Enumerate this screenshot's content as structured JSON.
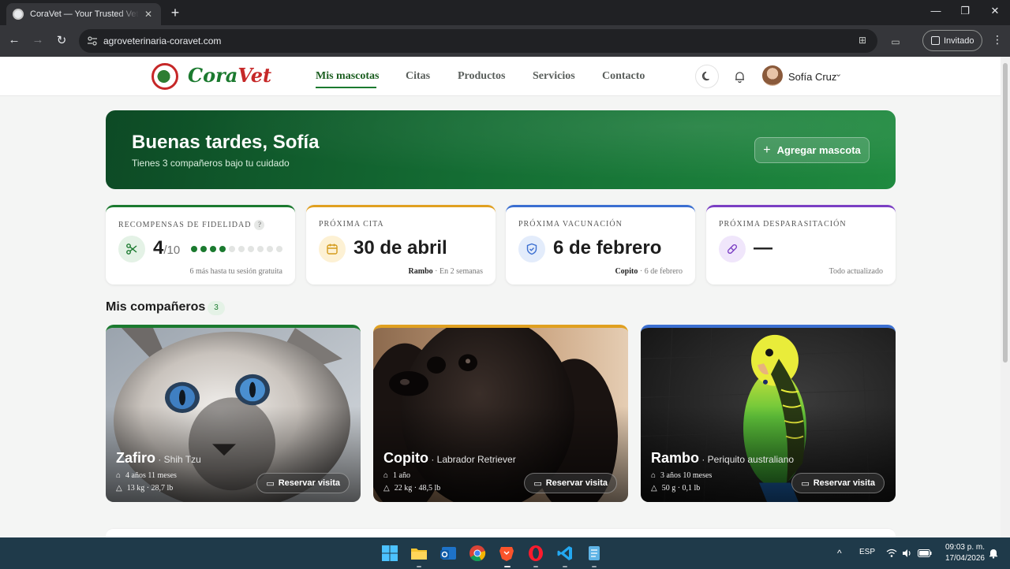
{
  "browser": {
    "tab_title": "CoraVet — Your Trusted Veterinary",
    "tab_close": "✕",
    "new_tab": "+",
    "url": "agroveterinaria-coravet.com",
    "profile_label": "Invitado",
    "controls": {
      "minimize": "—",
      "maximize": "❐",
      "close": "✕"
    }
  },
  "site": {
    "logo": {
      "part1": "Cora",
      "part2": "Vet"
    },
    "nav": [
      "Mis mascotas",
      "Citas",
      "Productos",
      "Servicios",
      "Contacto"
    ],
    "active_nav": "Mis mascotas",
    "user_name": "Sofía Cruz"
  },
  "hero": {
    "title": "Buenas tardes, Sofía",
    "subtitle": "Tienes 3 compañeros bajo tu cuidado",
    "button_label": "Agregar mascota"
  },
  "stats": {
    "loyalty": {
      "label": "Recompensas de fidelidad",
      "help": "?",
      "value": "4",
      "total": "/10",
      "progress": 4,
      "progress_max": 10,
      "footer": "6 más hasta tu sesión gratuita",
      "accent": "#1b7a2f"
    },
    "appointment": {
      "label": "Próxima cita",
      "value": "30 de abril",
      "footer_bold": "Rambo",
      "footer_rest": " · En 2 semanas",
      "accent": "#e0a020"
    },
    "vaccination": {
      "label": "Próxima vacunación",
      "value": "6 de febrero",
      "footer_bold": "Copito",
      "footer_rest": " · 6 de febrero",
      "accent": "#3b6fd1"
    },
    "deworming": {
      "label": "Próxima desparasitación",
      "value": "—",
      "footer": "Todo actualizado",
      "accent": "#7b3fc4"
    }
  },
  "pets_section": {
    "title": "Mis compañeros",
    "count": "3"
  },
  "pets": [
    {
      "name": "Zafiro",
      "breed": " · Shih Tzu",
      "age": "4 años 11 meses",
      "weight": "13  kg ·  28,7  lb",
      "button": "Reservar visita",
      "accent": "#1b7a2f"
    },
    {
      "name": "Copito",
      "breed": " · Labrador Retriever",
      "age": "1 año",
      "weight": "22  kg ·  48,5  lb",
      "button": "Reservar visita",
      "accent": "#e0a020"
    },
    {
      "name": "Rambo",
      "breed": " · Periquito australiano",
      "age": "3 años 10 meses",
      "weight": "50  g ·  0,1  lb",
      "button": "Reservar visita",
      "accent": "#3b6fd1"
    }
  ],
  "taskbar": {
    "language": "ESP",
    "time": "09:03 p. m.",
    "date": "17/04/2026",
    "chevron": "^"
  }
}
